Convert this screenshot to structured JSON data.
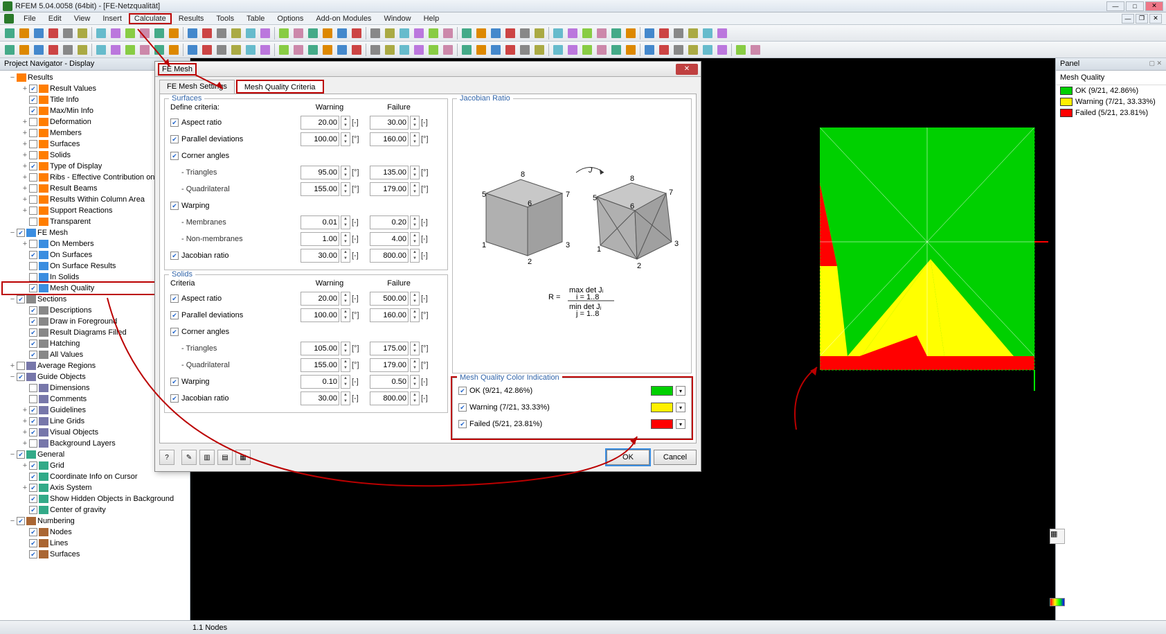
{
  "title": "RFEM 5.04.0058 (64bit) - [FE-Netzqualität]",
  "menus": [
    "File",
    "Edit",
    "View",
    "Insert",
    "Calculate",
    "Results",
    "Tools",
    "Table",
    "Options",
    "Add-on Modules",
    "Window",
    "Help"
  ],
  "menu_highlight": "Calculate",
  "navigator": {
    "title": "Project Navigator - Display",
    "tree": [
      {
        "l": 0,
        "tw": "−",
        "chk": null,
        "ico": "#ff7d00",
        "label": "Results"
      },
      {
        "l": 1,
        "tw": "+",
        "chk": true,
        "ico": "#ff7d00",
        "label": "Result Values"
      },
      {
        "l": 1,
        "tw": "",
        "chk": true,
        "ico": "#ff7d00",
        "label": "Title Info"
      },
      {
        "l": 1,
        "tw": "",
        "chk": true,
        "ico": "#ff7d00",
        "label": "Max/Min Info"
      },
      {
        "l": 1,
        "tw": "+",
        "chk": false,
        "ico": "#ff7d00",
        "label": "Deformation"
      },
      {
        "l": 1,
        "tw": "+",
        "chk": false,
        "ico": "#ff7d00",
        "label": "Members"
      },
      {
        "l": 1,
        "tw": "+",
        "chk": false,
        "ico": "#ff7d00",
        "label": "Surfaces"
      },
      {
        "l": 1,
        "tw": "+",
        "chk": false,
        "ico": "#ff7d00",
        "label": "Solids"
      },
      {
        "l": 1,
        "tw": "+",
        "chk": true,
        "ico": "#ff7d00",
        "label": "Type of Display"
      },
      {
        "l": 1,
        "tw": "+",
        "chk": false,
        "ico": "#ff7d00",
        "label": "Ribs - Effective Contribution on Surfaces"
      },
      {
        "l": 1,
        "tw": "+",
        "chk": false,
        "ico": "#ff7d00",
        "label": "Result Beams"
      },
      {
        "l": 1,
        "tw": "+",
        "chk": false,
        "ico": "#ff7d00",
        "label": "Results Within Column Area"
      },
      {
        "l": 1,
        "tw": "+",
        "chk": false,
        "ico": "#ff7d00",
        "label": "Support Reactions"
      },
      {
        "l": 1,
        "tw": "",
        "chk": false,
        "ico": "#ff7d00",
        "label": "Transparent"
      },
      {
        "l": 0,
        "tw": "−",
        "chk": true,
        "ico": "#3a8de0",
        "label": "FE Mesh"
      },
      {
        "l": 1,
        "tw": "+",
        "chk": false,
        "ico": "#3a8de0",
        "label": "On Members"
      },
      {
        "l": 1,
        "tw": "",
        "chk": true,
        "ico": "#3a8de0",
        "label": "On Surfaces"
      },
      {
        "l": 1,
        "tw": "",
        "chk": false,
        "ico": "#3a8de0",
        "label": "On Surface Results"
      },
      {
        "l": 1,
        "tw": "",
        "chk": false,
        "ico": "#3a8de0",
        "label": "In Solids"
      },
      {
        "l": 1,
        "tw": "",
        "chk": true,
        "ico": "#3a8de0",
        "label": "Mesh Quality",
        "hl": true
      },
      {
        "l": 0,
        "tw": "−",
        "chk": true,
        "ico": "#888",
        "label": "Sections"
      },
      {
        "l": 1,
        "tw": "",
        "chk": true,
        "ico": "#888",
        "label": "Descriptions"
      },
      {
        "l": 1,
        "tw": "",
        "chk": true,
        "ico": "#888",
        "label": "Draw in Foreground"
      },
      {
        "l": 1,
        "tw": "",
        "chk": true,
        "ico": "#888",
        "label": "Result Diagrams Filled"
      },
      {
        "l": 1,
        "tw": "",
        "chk": true,
        "ico": "#888",
        "label": "Hatching"
      },
      {
        "l": 1,
        "tw": "",
        "chk": true,
        "ico": "#888",
        "label": "All Values"
      },
      {
        "l": 0,
        "tw": "+",
        "chk": false,
        "ico": "#77a",
        "label": "Average Regions"
      },
      {
        "l": 0,
        "tw": "−",
        "chk": true,
        "ico": "#77a",
        "label": "Guide Objects"
      },
      {
        "l": 1,
        "tw": "",
        "chk": false,
        "ico": "#77a",
        "label": "Dimensions"
      },
      {
        "l": 1,
        "tw": "",
        "chk": false,
        "ico": "#77a",
        "label": "Comments"
      },
      {
        "l": 1,
        "tw": "+",
        "chk": true,
        "ico": "#77a",
        "label": "Guidelines"
      },
      {
        "l": 1,
        "tw": "+",
        "chk": true,
        "ico": "#77a",
        "label": "Line Grids"
      },
      {
        "l": 1,
        "tw": "+",
        "chk": true,
        "ico": "#77a",
        "label": "Visual Objects"
      },
      {
        "l": 1,
        "tw": "+",
        "chk": false,
        "ico": "#77a",
        "label": "Background Layers"
      },
      {
        "l": 0,
        "tw": "−",
        "chk": true,
        "ico": "#3a8",
        "label": "General"
      },
      {
        "l": 1,
        "tw": "+",
        "chk": true,
        "ico": "#3a8",
        "label": "Grid"
      },
      {
        "l": 1,
        "tw": "",
        "chk": true,
        "ico": "#3a8",
        "label": "Coordinate Info on Cursor"
      },
      {
        "l": 1,
        "tw": "+",
        "chk": true,
        "ico": "#3a8",
        "label": "Axis System"
      },
      {
        "l": 1,
        "tw": "",
        "chk": true,
        "ico": "#3a8",
        "label": "Show Hidden Objects in Background"
      },
      {
        "l": 1,
        "tw": "",
        "chk": true,
        "ico": "#3a8",
        "label": "Center of gravity"
      },
      {
        "l": 0,
        "tw": "−",
        "chk": true,
        "ico": "#a63",
        "label": "Numbering"
      },
      {
        "l": 1,
        "tw": "",
        "chk": true,
        "ico": "#a63",
        "label": "Nodes"
      },
      {
        "l": 1,
        "tw": "",
        "chk": true,
        "ico": "#a63",
        "label": "Lines"
      },
      {
        "l": 1,
        "tw": "",
        "chk": true,
        "ico": "#a63",
        "label": "Surfaces"
      }
    ]
  },
  "dialog": {
    "title": "FE Mesh",
    "tabs": [
      "FE Mesh Settings",
      "Mesh Quality Criteria"
    ],
    "active_tab": 1,
    "surfaces": {
      "title": "Surfaces",
      "define_label": "Define criteria:",
      "warning_label": "Warning",
      "failure_label": "Failure",
      "rows": [
        {
          "label": "Aspect ratio",
          "chk": true,
          "warn": "20.00",
          "fail": "30.00",
          "unit": "[-]"
        },
        {
          "label": "Parallel deviations",
          "chk": true,
          "warn": "100.00",
          "fail": "160.00",
          "unit": "[°]"
        },
        {
          "label": "Corner angles",
          "chk": true,
          "warn": "",
          "fail": "",
          "unit": ""
        },
        {
          "label": "- Triangles",
          "sub": true,
          "warn": "95.00",
          "fail": "135.00",
          "unit": "[°]"
        },
        {
          "label": "- Quadrilateral",
          "sub": true,
          "warn": "155.00",
          "fail": "179.00",
          "unit": "[°]"
        },
        {
          "label": "Warping",
          "chk": true,
          "warn": "",
          "fail": "",
          "unit": ""
        },
        {
          "label": "- Membranes",
          "sub": true,
          "warn": "0.01",
          "fail": "0.20",
          "unit": "[-]"
        },
        {
          "label": "- Non-membranes",
          "sub": true,
          "warn": "1.00",
          "fail": "4.00",
          "unit": "[-]"
        },
        {
          "label": "Jacobian ratio",
          "chk": true,
          "warn": "30.00",
          "fail": "800.00",
          "unit": "[-]"
        }
      ]
    },
    "solids": {
      "title": "Solids",
      "criteria_label": "Criteria",
      "warning_label": "Warning",
      "failure_label": "Failure",
      "rows": [
        {
          "label": "Aspect ratio",
          "chk": true,
          "warn": "20.00",
          "fail": "500.00",
          "unit": "[-]"
        },
        {
          "label": "Parallel deviations",
          "chk": true,
          "warn": "100.00",
          "fail": "160.00",
          "unit": "[°]"
        },
        {
          "label": "Corner angles",
          "chk": true,
          "warn": "",
          "fail": "",
          "unit": ""
        },
        {
          "label": "- Triangles",
          "sub": true,
          "warn": "105.00",
          "fail": "175.00",
          "unit": "[°]"
        },
        {
          "label": "- Quadrilateral",
          "sub": true,
          "warn": "155.00",
          "fail": "179.00",
          "unit": "[°]"
        },
        {
          "label": "Warping",
          "chk": true,
          "warn": "0.10",
          "fail": "0.50",
          "unit": "[-]"
        },
        {
          "label": "Jacobian ratio",
          "chk": true,
          "warn": "30.00",
          "fail": "800.00",
          "unit": "[-]"
        }
      ]
    },
    "jacobian": {
      "title": "Jacobian Ratio",
      "formula_top": "max det Jᵢ",
      "formula_bot": "min det Jⱼ",
      "formula_i": "i = 1..8",
      "formula_j": "j = 1..8",
      "formula_R": "R ="
    },
    "color_indication": {
      "title": "Mesh Quality Color Indication",
      "rows": [
        {
          "label": "OK (9/21, 42.86%)",
          "color": "#00d000"
        },
        {
          "label": "Warning (7/21, 33.33%)",
          "color": "#fff000"
        },
        {
          "label": "Failed (5/21, 23.81%)",
          "color": "#ff0000"
        }
      ]
    },
    "ok": "OK",
    "cancel": "Cancel"
  },
  "panel": {
    "title": "Panel",
    "subtitle": "Mesh Quality",
    "rows": [
      {
        "label": "OK (9/21, 42.86%)",
        "color": "#00d000"
      },
      {
        "label": "Warning (7/21, 33.33%)",
        "color": "#fff000"
      },
      {
        "label": "Failed (5/21, 23.81%)",
        "color": "#ff0000"
      }
    ]
  },
  "status": "1.1 Nodes"
}
